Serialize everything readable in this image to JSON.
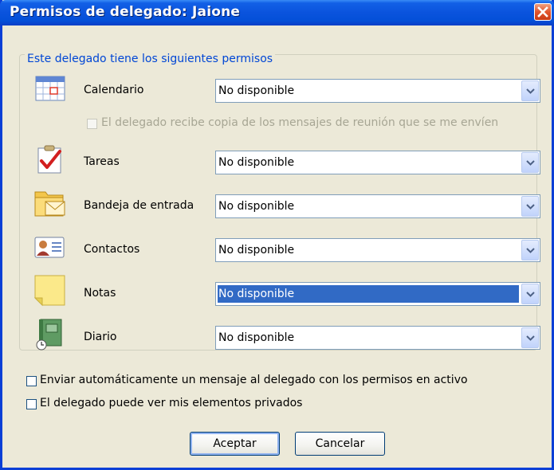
{
  "window": {
    "title": "Permisos de delegado: Jaione"
  },
  "group": {
    "legend": "Este delegado tiene los siguientes permisos"
  },
  "rows": [
    {
      "label": "Calendario",
      "value": "No disponible",
      "icon": "calendar-icon"
    },
    {
      "label": "Tareas",
      "value": "No disponible",
      "icon": "tasks-icon"
    },
    {
      "label": "Bandeja de entrada",
      "value": "No disponible",
      "icon": "inbox-icon"
    },
    {
      "label": "Contactos",
      "value": "No disponible",
      "icon": "contacts-icon"
    },
    {
      "label": "Notas",
      "value": "No disponible",
      "icon": "notes-icon"
    },
    {
      "label": "Diario",
      "value": "No disponible",
      "icon": "journal-icon"
    }
  ],
  "meeting_copy": {
    "label": "El delegado recibe copia de los mensajes de reunión que se me envíen",
    "checked": false,
    "enabled": false
  },
  "options": [
    {
      "label": "Enviar automáticamente un mensaje al delegado con los permisos en activo",
      "checked": false
    },
    {
      "label": "El delegado puede ver mis elementos privados",
      "checked": false
    }
  ],
  "buttons": {
    "ok": "Aceptar",
    "cancel": "Cancelar"
  },
  "colors": {
    "titlebar": "#0a53dd",
    "selection": "#316ac5",
    "legend": "#0046d5",
    "face": "#ece9d8"
  }
}
